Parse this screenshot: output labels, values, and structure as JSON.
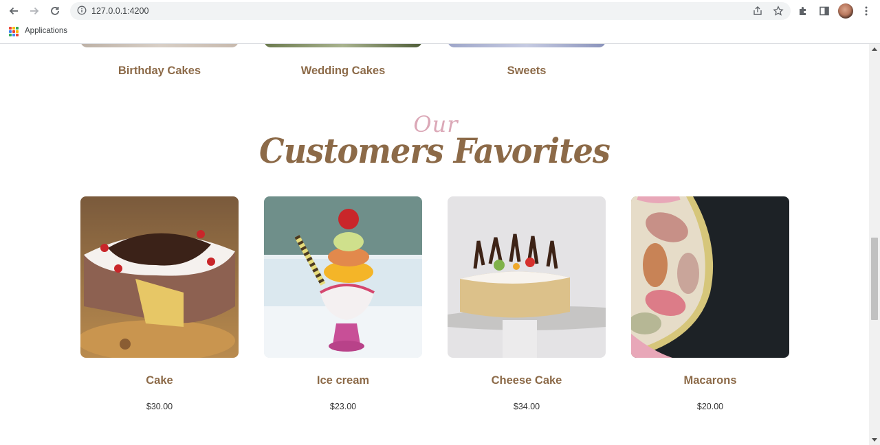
{
  "browser": {
    "url": "127.0.0.1:4200",
    "bookmarks_label": "Applications"
  },
  "categories": [
    {
      "title": "Birthday Cakes",
      "image": "birthday-cakes"
    },
    {
      "title": "Wedding Cakes",
      "image": "wedding-cakes"
    },
    {
      "title": "Sweets",
      "image": "sweets"
    }
  ],
  "section": {
    "heading_small": "Our",
    "heading_main": "Customers Favorites"
  },
  "products": [
    {
      "name": "Cake",
      "price": "$30.00"
    },
    {
      "name": "Ice cream",
      "price": "$23.00"
    },
    {
      "name": "Cheese Cake",
      "price": "$34.00"
    },
    {
      "name": "Macarons",
      "price": "$20.00"
    }
  ],
  "colors": {
    "accent": "#8c6a48",
    "accent_pink": "#dba8b7"
  }
}
